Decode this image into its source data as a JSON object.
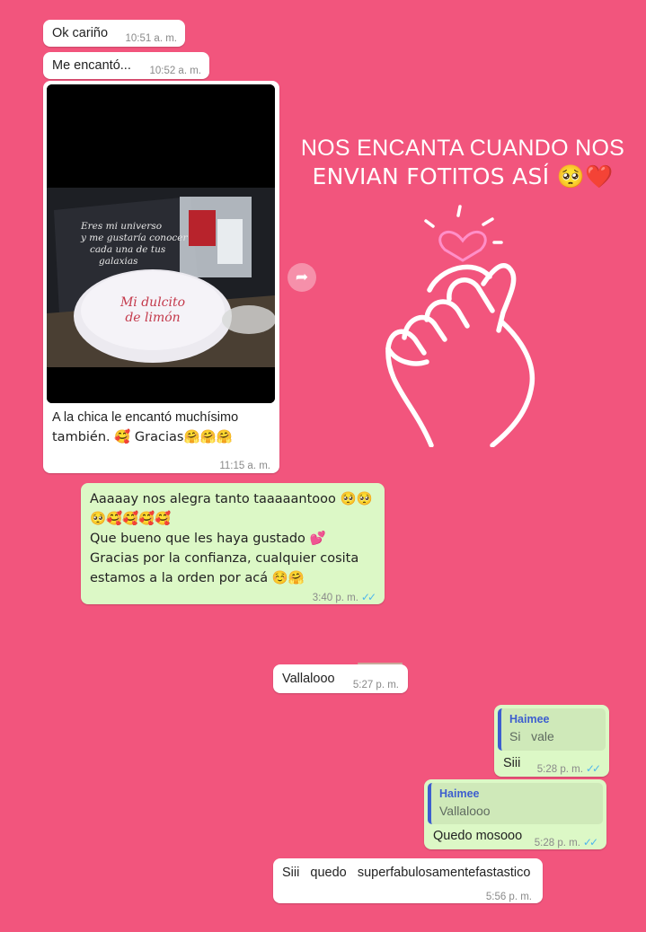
{
  "overlay": {
    "heading_line1": "NOS ENCANTA CUANDO NOS",
    "heading_line2": "ENVIAN FOTITOS ASÍ 🥺❤️",
    "sticker_icon": "finger-heart-icon",
    "colors": {
      "background": "#f2557d",
      "incoming": "#ffffff",
      "outgoing": "#dcf8c6",
      "read_ticks": "#4fb6ec",
      "quote_bar": "#3d5ecf"
    }
  },
  "messages": [
    {
      "id": "m1",
      "direction": "in",
      "text": "Ok cariño",
      "time": "10:51 a. m."
    },
    {
      "id": "m2",
      "direction": "in",
      "text": "Me encantó...",
      "time": "10:52 a. m."
    },
    {
      "id": "m3",
      "direction": "in",
      "type": "image",
      "image_text_lines": [
        "Eres mi universo",
        "y me gustaría conocer",
        "cada una de tus",
        "galaxias"
      ],
      "box_text_lines": [
        "Mi dulcito",
        "de limón"
      ],
      "caption_line1": "A la chica le encantó muchísimo",
      "caption_line2": "también. 🥰 Gracias🤗🤗🤗",
      "time": "11:15 a. m."
    },
    {
      "id": "m4",
      "direction": "out",
      "lines": [
        "Aaaaay nos alegra tanto taaaaantooo 🥺🥺",
        "🥺🥰🥰🥰🥰",
        "Que bueno que les haya gustado 💕",
        "Gracias por la confianza, cualquier cosita",
        "estamos a la orden por acá ☺️🤗"
      ],
      "time": "3:40 p. m.",
      "status": "✓✓"
    },
    {
      "id": "m5",
      "direction": "in",
      "text": "Vallalooo",
      "time": "5:27 p. m."
    },
    {
      "id": "m6",
      "direction": "out",
      "quote_name": "Haimee",
      "quote_text": "Si   vale",
      "text": "Siii",
      "time": "5:28 p. m.",
      "status": "✓✓"
    },
    {
      "id": "m7",
      "direction": "out",
      "quote_name": "Haimee",
      "quote_text": "Vallalooo",
      "text": "Quedo mosooo",
      "time": "5:28 p. m.",
      "status": "✓✓"
    },
    {
      "id": "m8",
      "direction": "in",
      "text": "Siii   quedo   superfabulosamentefastastico",
      "time": "5:56 p. m."
    }
  ]
}
